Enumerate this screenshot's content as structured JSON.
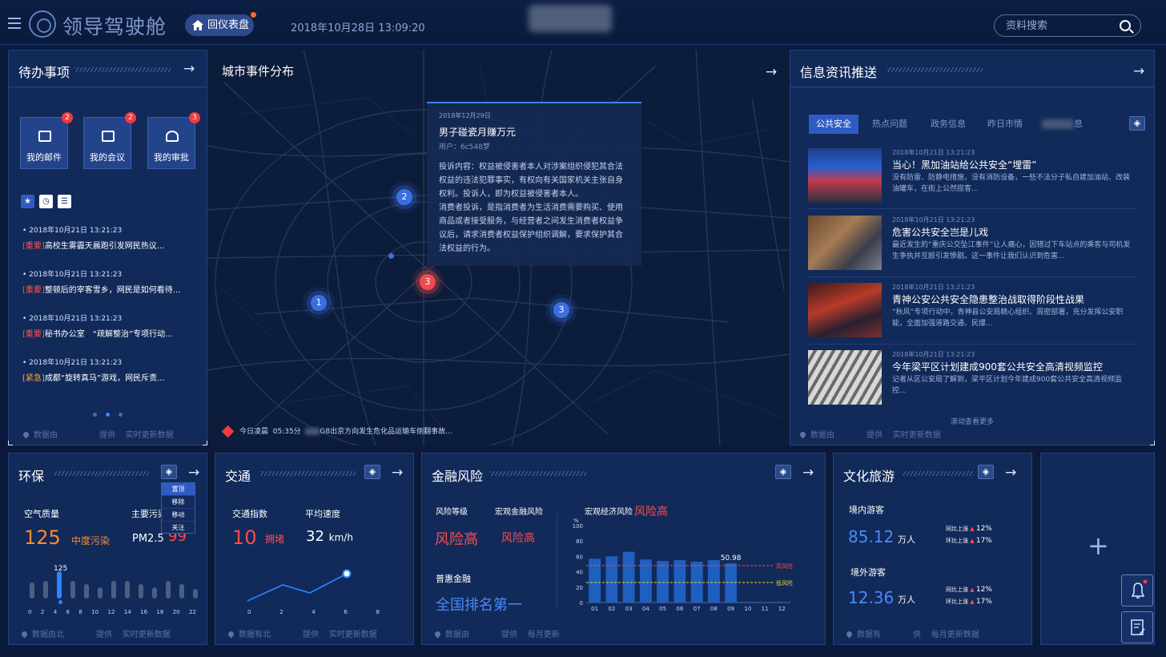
{
  "header": {
    "title": "领导驾驶舱",
    "dashboard_button": "回仪表盘",
    "datetime": "2018年10月28日 13:09:20",
    "search_placeholder": "资料搜索"
  },
  "todo": {
    "title": "待办事项",
    "cards": [
      {
        "label": "我的邮件",
        "badge": "2"
      },
      {
        "label": "我的会议",
        "badge": "2"
      },
      {
        "label": "我的审批",
        "badge": "3"
      }
    ],
    "items": [
      {
        "date": "• 2018年10月21日 13:21:23",
        "tag": "[重要]",
        "text": "高校生雾霾天晨跑引发网民热议..."
      },
      {
        "date": "• 2018年10月21日 13:21:23",
        "tag": "[重要]",
        "text": "整顿后的宰客雪乡，网民是如何看待..."
      },
      {
        "date": "• 2018年10月21日 13:21:23",
        "tag": "[重要]",
        "text": "秘书办公室　“疏解整治”专项行动..."
      },
      {
        "date": "• 2018年10月21日 13:21:23",
        "tag": "[紧急]",
        "text": "成都“旋转真马”游戏，网民斥责..."
      }
    ],
    "footer_a": "数据由",
    "footer_b": "提供",
    "footer_c": "实时更新数据"
  },
  "map": {
    "title": "城市事件分布",
    "markers": [
      "2",
      "3",
      "1",
      "3"
    ],
    "popup": {
      "date": "2018年12月29日",
      "title": "男子碰瓷月赚万元",
      "user": "用户：6c548梦",
      "body1": "投诉内容：权益被侵害者本人对涉案组织侵犯其合法权益的违法犯罪事实，有权向有关国家机关主张自身权利。投诉人，即为权益被侵害者本人。",
      "body2": "消费者投诉，是指消费者为生活消费需要购买、使用商品或者接受服务，与经营者之间发生消费者权益争议后，请求消费者权益保护组织调解，要求保护其合法权益的行为。"
    },
    "alert_prefix": "今日凌晨",
    "alert_time": "05:35分",
    "alert_text": "G8出京方向发生危化品运输车侧翻事故..."
  },
  "info": {
    "title": "信息资讯推送",
    "tabs": [
      "公共安全",
      "热点问题",
      "政务信息",
      "昨日市情",
      "息"
    ],
    "news": [
      {
        "date": "2018年10月21日 13:21:23",
        "title": "当心！黑加油站给公共安全“埋雷”",
        "summary": "没有防雷、防静电措施，没有消防设备，一些不法分子私自建加油站、改装油罐车，在街上公然揽客..."
      },
      {
        "date": "2018年10月21日 13:21:23",
        "title": "危害公共安全岂是儿戏",
        "summary": "最近发生的“重庆公交坠江事件”让人痛心，因错过下车站点的乘客与司机发生争执并互殴引发惨剧。这一事件让我们认识到危害..."
      },
      {
        "date": "2018年10月21日 13:21:23",
        "title": "青神公安公共安全隐患整治战取得阶段性战果",
        "summary": "“秋风”专项行动中，青神县公安局精心组织、周密部署，充分发挥公安职能，全面加强道路交通、民爆..."
      },
      {
        "date": "2018年10月21日 13:21:23",
        "title": "今年梁平区计划建成900套公共安全高清视频监控",
        "summary": "记者从区公安局了解到，梁平区计划今年建成900套公共安全高清视频监控..."
      }
    ],
    "more": "滚动查看更多",
    "footer_a": "数据由",
    "footer_b": "提供",
    "footer_c": "实时更新数据"
  },
  "env": {
    "title": "环保",
    "air_label": "空气质量",
    "air_value": "125",
    "air_level": "中度污染",
    "pollutant_label": "主要污染",
    "pollutant_name": "PM2.5",
    "pollutant_value": "99",
    "chart_peak_label": "125",
    "x_ticks": [
      "0",
      "2",
      "4",
      "6",
      "8",
      "10",
      "12",
      "14",
      "16",
      "18",
      "20",
      "22"
    ],
    "menu": [
      "置顶",
      "移除",
      "移动",
      "关注"
    ],
    "footer_a": "数据由北",
    "footer_b": "提供",
    "footer_c": "实时更新数据"
  },
  "traffic": {
    "title": "交通",
    "index_label": "交通指数",
    "index_value": "10",
    "index_level": "拥堵",
    "speed_label": "平均速度",
    "speed_value": "32",
    "speed_unit": "km/h",
    "x_ticks": [
      "0",
      "2",
      "4",
      "6",
      "8"
    ],
    "footer_a": "数据有北",
    "footer_b": "提供",
    "footer_c": "实时更新数据"
  },
  "finance": {
    "title": "金融风险",
    "risk_label": "风险等级",
    "risk_value": "风险高",
    "macro_fin_label": "宏观金融风险",
    "macro_fin_value": "风险高",
    "macro_eco_label": "宏观经济风险",
    "macro_eco_value": "风险高",
    "inclusive_label": "普惠金融",
    "inclusive_value": "全国排名第一",
    "footer_a": "数据由",
    "footer_b": "提供",
    "footer_c": "每月更新"
  },
  "tourism": {
    "title": "文化旅游",
    "domestic_label": "境内游客",
    "domestic_value": "85.12",
    "domestic_unit": "万人",
    "foreign_label": "境外游客",
    "foreign_value": "12.36",
    "foreign_unit": "万人",
    "mom_label": "同比上涨",
    "yoy_label": "环比上涨",
    "d_mom": "12%",
    "d_yoy": "17%",
    "f_mom": "12%",
    "f_yoy": "17%",
    "footer_a": "数据有",
    "footer_b": "供",
    "footer_c": "每月更新数据"
  },
  "chart_data": {
    "type": "bar",
    "categories": [
      "01",
      "02",
      "03",
      "04",
      "05",
      "06",
      "07",
      "08",
      "09",
      "10",
      "11",
      "12"
    ],
    "values": [
      57,
      60,
      66,
      56,
      54,
      55,
      53,
      55,
      50.98,
      null,
      null,
      null
    ],
    "ylabel": "%",
    "ylim": [
      0,
      100
    ],
    "yticks": [
      0,
      20,
      40,
      60,
      80,
      100
    ],
    "value_label": "50.98",
    "thresholds": [
      {
        "name": "高风险",
        "value": 48,
        "color": "#ff4b4b"
      },
      {
        "name": "低风险",
        "value": 26,
        "color": "#f0d63c"
      }
    ],
    "bar_color": "#1f5fbf"
  }
}
